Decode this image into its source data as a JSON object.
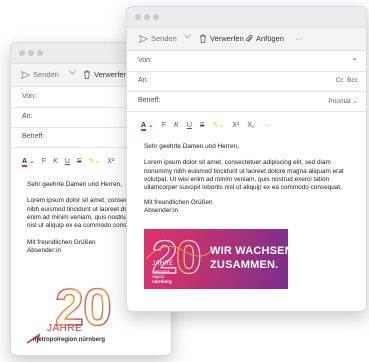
{
  "back": {
    "toolbar": {
      "send_label": "Senden",
      "discard_label": "Verwerfen"
    },
    "fields": {
      "to_label": "Von:",
      "an_label": "An:",
      "subject_label": "Betreff:"
    },
    "body": {
      "greeting": "Sehr geehrte Damen und Herren,",
      "paragraph": [
        "Lorem ipsum dolor sit amet, consecte",
        "nibh euismod tincidunt ut laoreet do",
        "enim ad minim veniam, quis nostrud",
        "nisl ut aliquip ex ea commodo consec"
      ],
      "closing": "Mit freundlichen Grüßen",
      "sender": "Absender:in"
    },
    "logo": {
      "number": "20",
      "jahre": "JAHRE",
      "region": "metropolregion nürnberg"
    }
  },
  "front": {
    "toolbar": {
      "send_label": "Senden",
      "discard_label": "Verwerfen",
      "attach_label": "Anfügen",
      "more_label": "···"
    },
    "fields": {
      "from_label": "Von:",
      "to_label": "An:",
      "cc_label": "Cc",
      "bcc_label": "Bcc",
      "subject_label": "Betreff:",
      "priority_label": "Priorität"
    },
    "body": {
      "greeting": "Sehr geehrte Damen und Herren,",
      "paragraph": "Lorem ipsum dolor sit amet, consectetuer adipiscing elit, sed diam nonummy nibh euismod tincidunt ut laoreet dolore magna aliquam erat volutpat. Ut wisi enim ad minim veniam, quis nostrud exerci tation ullamcorper suscipit lobortis nisl ut aliquip ex ea commodo consequat.",
      "closing": "Mit freundlichen Grüßen",
      "sender": "Absender:in"
    },
    "banner": {
      "number": "20",
      "jahre": "JAHRE",
      "region_line1": "metropol",
      "region_line2": "region",
      "region_line3": "nürnberg",
      "headline1": "WIR WACHSEN",
      "headline2": "ZUSAMMEN."
    }
  },
  "colors": {
    "accent_red": "#d9344a",
    "banner_magenta": "#e0306e",
    "banner_orange": "#f39a3a",
    "banner_purple": "#7b2f8e"
  }
}
